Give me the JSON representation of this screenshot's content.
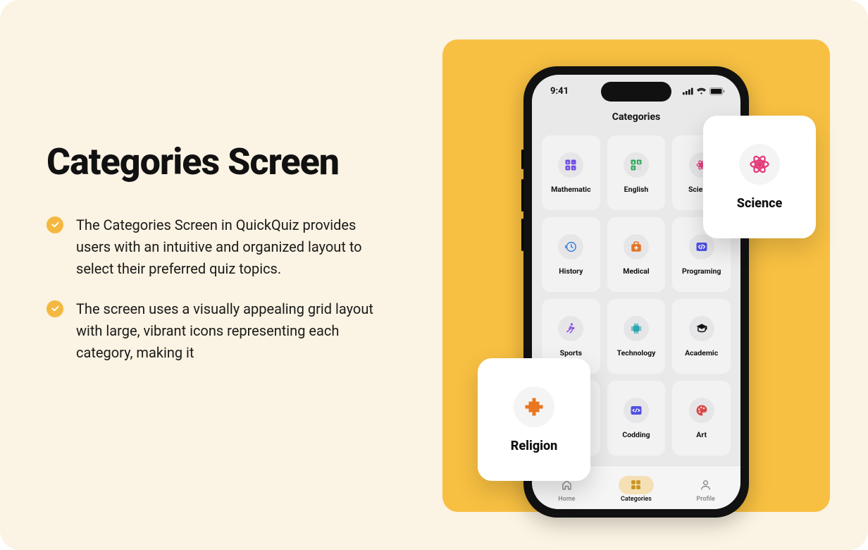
{
  "title": "Categories Screen",
  "bullets": [
    "The Categories Screen in QuickQuiz provides users with an intuitive and organized layout to select their preferred quiz topics.",
    "The screen uses a visually appealing grid layout with large, vibrant icons representing each category, making it"
  ],
  "phone": {
    "time": "9:41",
    "screen_title": "Categories",
    "categories": [
      {
        "label": "Mathematic",
        "slug": "mathematic",
        "icon": "math",
        "color": "#6F4FE3"
      },
      {
        "label": "English",
        "slug": "english",
        "icon": "english",
        "color": "#2FA85A"
      },
      {
        "label": "Science",
        "slug": "science",
        "icon": "science",
        "color": "#E33A7A"
      },
      {
        "label": "History",
        "slug": "history",
        "icon": "history",
        "color": "#3B7FD9"
      },
      {
        "label": "Medical",
        "slug": "medical",
        "icon": "medical",
        "color": "#E37326"
      },
      {
        "label": "Programing",
        "slug": "programing",
        "icon": "programing",
        "color": "#4F4FE3"
      },
      {
        "label": "Sports",
        "slug": "sports",
        "icon": "sports",
        "color": "#8A4FE3"
      },
      {
        "label": "Technology",
        "slug": "technology",
        "icon": "technology",
        "color": "#2FA6B0"
      },
      {
        "label": "Academic",
        "slug": "academic",
        "icon": "academic",
        "color": "#111111"
      },
      {
        "label": "Religion",
        "slug": "religion",
        "icon": "religion",
        "color": "#E37326"
      },
      {
        "label": "Codding",
        "slug": "codding",
        "icon": "codding",
        "color": "#4F4FE3"
      },
      {
        "label": "Art",
        "slug": "art",
        "icon": "art",
        "color": "#D84A4A"
      }
    ],
    "nav": [
      {
        "label": "Home",
        "icon": "home",
        "active": false
      },
      {
        "label": "Categories",
        "icon": "grid",
        "active": true
      },
      {
        "label": "Profile",
        "icon": "user",
        "active": false
      }
    ]
  },
  "popouts": {
    "science": {
      "label": "Science",
      "icon": "science",
      "color": "#E33A7A"
    },
    "religion": {
      "label": "Religion",
      "icon": "religion",
      "color": "#E87722"
    }
  }
}
